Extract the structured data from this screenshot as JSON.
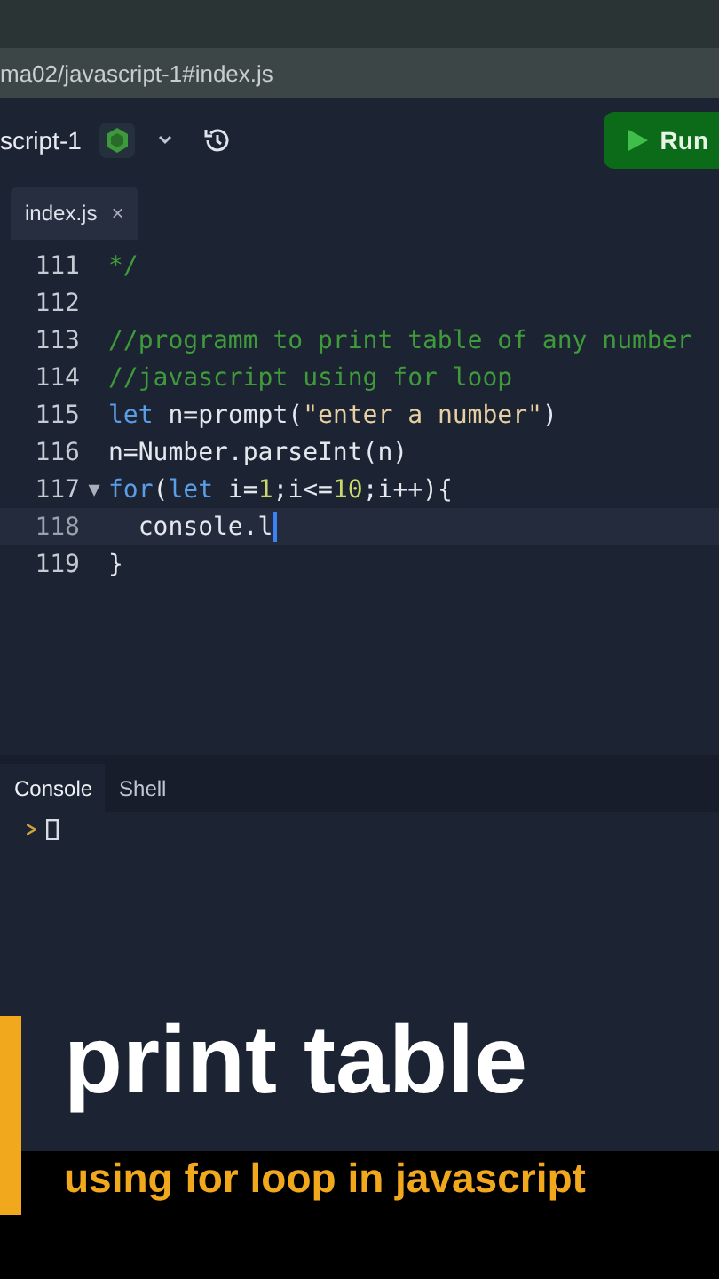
{
  "browser": {
    "url": "ma02/javascript-1#index.js"
  },
  "toolbar": {
    "project": "script-1",
    "run_label": "Run"
  },
  "editor_tabs": [
    {
      "label": "index.js",
      "close": "×",
      "selected": true
    }
  ],
  "code_lines": [
    {
      "number": "111",
      "current": false,
      "tokens": [
        {
          "kind": "comment",
          "text": "*/"
        }
      ]
    },
    {
      "number": "112",
      "current": false
    },
    {
      "number": "113",
      "current": false,
      "tokens": [
        {
          "kind": "comment",
          "text": "//programm to print table of any number"
        }
      ]
    },
    {
      "number": "114",
      "current": false,
      "tokens": [
        {
          "kind": "comment",
          "text": "//javascript using for loop"
        }
      ]
    },
    {
      "number": "115",
      "current": false,
      "tokens": [
        {
          "kind": "keyword",
          "text": "let"
        },
        {
          "kind": "plain",
          "text": " n=prompt("
        },
        {
          "kind": "string",
          "text": "\"enter a number\""
        },
        {
          "kind": "plain",
          "text": ")"
        }
      ]
    },
    {
      "number": "116",
      "current": false,
      "tokens": [
        {
          "kind": "plain",
          "text": "n=Number.parseInt(n)"
        }
      ]
    },
    {
      "number": "117",
      "current": false,
      "fold_marker": "▼",
      "tokens": [
        {
          "kind": "keyword",
          "text": "for"
        },
        {
          "kind": "plain",
          "text": "("
        },
        {
          "kind": "keyword",
          "text": "let"
        },
        {
          "kind": "plain",
          "text": " i="
        },
        {
          "kind": "number",
          "text": "1"
        },
        {
          "kind": "plain",
          "text": ";i<="
        },
        {
          "kind": "number",
          "text": "10"
        },
        {
          "kind": "plain",
          "text": ";i++){"
        }
      ]
    },
    {
      "number": "118",
      "current": true,
      "tokens": [
        {
          "kind": "plain",
          "text": "  console.l"
        }
      ]
    },
    {
      "number": "119",
      "current": false,
      "tokens": [
        {
          "kind": "plain",
          "text": "}"
        }
      ]
    }
  ],
  "panel_tabs": [
    {
      "label": "Console",
      "selected": true
    },
    {
      "label": "Shell",
      "selected": false
    }
  ],
  "caption": {
    "title": "print table",
    "subtitle": "using for loop in javascript"
  }
}
